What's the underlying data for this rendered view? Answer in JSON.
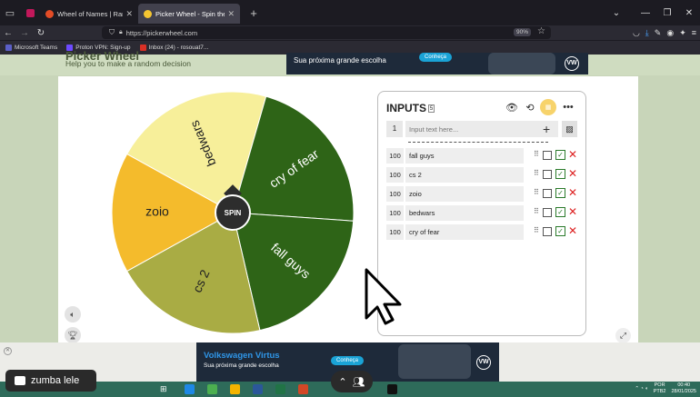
{
  "tabs": [
    {
      "title": "Wheel of Names | Random nam",
      "active": false,
      "color": "#e34c26"
    },
    {
      "title": "Picker Wheel - Spin the Wheel t",
      "active": true,
      "color": "#f4c531"
    }
  ],
  "url": "https://pickerwheel.com",
  "zoom": "90%",
  "bookmarks": [
    {
      "label": "Microsoft Teams",
      "color": "#5b5fc7"
    },
    {
      "label": "Proton VPN: Sign-up",
      "color": "#6d4aff"
    },
    {
      "label": "Inbox (24) - rosouat7...",
      "color": "#d93025"
    }
  ],
  "site": {
    "title": "Picker Wheel",
    "subtitle": "Help you to make a random decision"
  },
  "ad_top": {
    "text": "Sua próxima grande escolha",
    "button": "Conheça",
    "logo": "VW"
  },
  "wheel": {
    "spin_label": "SPIN",
    "segments": [
      {
        "label": "bedwars",
        "color": "#f7ef9a"
      },
      {
        "label": "cry of fear",
        "color": "#2e6417"
      },
      {
        "label": "fall guys",
        "color": "#2e6417"
      },
      {
        "label": "cs 2",
        "color": "#a9ac44"
      },
      {
        "label": "zoio",
        "color": "#f4bb2c"
      }
    ]
  },
  "panel": {
    "title": "INPUTS",
    "count_badge": "5",
    "input_number": "1",
    "placeholder": "Input text here...",
    "entries": [
      {
        "weight": "100",
        "name": "fall guys"
      },
      {
        "weight": "100",
        "name": "cs 2"
      },
      {
        "weight": "100",
        "name": "zoio"
      },
      {
        "weight": "100",
        "name": "bedwars"
      },
      {
        "weight": "100",
        "name": "cry of fear"
      }
    ]
  },
  "ad_bottom": {
    "title": "Volkswagen Virtus",
    "text": "Sua próxima grande escolha",
    "button": "Conheça",
    "logo": "VW"
  },
  "toast": {
    "label": "zumba lele"
  },
  "system": {
    "lang1": "POR",
    "lang2": "PTB2",
    "time": "00:40",
    "date": "28/01/2025"
  }
}
